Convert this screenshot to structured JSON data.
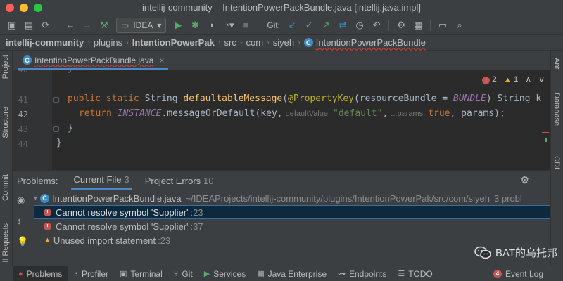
{
  "window": {
    "title": "intellij-community – IntentionPowerPackBundle.java [intellij.java.impl]"
  },
  "toolbar": {
    "run_config": "IDEA",
    "git_label": "Git:"
  },
  "breadcrumb": [
    {
      "label": "intellij-community",
      "bold": true
    },
    {
      "label": "plugins",
      "bold": false
    },
    {
      "label": "IntentionPowerPak",
      "bold": true
    },
    {
      "label": "src",
      "bold": false
    },
    {
      "label": "com",
      "bold": false
    },
    {
      "label": "siyeh",
      "bold": false
    },
    {
      "label": "IntentionPowerPackBundle",
      "bold": false,
      "class_icon": true
    }
  ],
  "left_stripe": {
    "project": "Project",
    "structure": "Structure",
    "commit": "Commit",
    "requests": "II Requests"
  },
  "right_stripe": {
    "ant": "Ant",
    "database": "Database",
    "cdi": "CDI"
  },
  "editor_tab": {
    "label": "IntentionPowerPackBundle.java",
    "icon": "C"
  },
  "inspections": {
    "errors": "2",
    "warnings": "1"
  },
  "editor": {
    "lines": [
      {
        "num": "40",
        "code": "}"
      },
      {
        "num": "41",
        "kw1": "public static ",
        "type": "String ",
        "fn": "defaultableMessage",
        "p1": "(",
        "ann": "@PropertyKey",
        "p2": "(resourceBundle = ",
        "const": "BUNDLE",
        "p3": ") String k"
      },
      {
        "num": "42",
        "kw": "return ",
        "const": "INSTANCE",
        "m": ".messageOrDefault(key,",
        "hint1": "defaultValue:",
        "str": "\"default\"",
        "comma": ",",
        "hint2": "...params:",
        "kw2": "true",
        "rest": ", params);"
      },
      {
        "num": "43",
        "code": "}"
      },
      {
        "num": "44",
        "code": "}"
      }
    ]
  },
  "problems": {
    "title": "Problems:",
    "tabs": [
      {
        "label": "Current File",
        "count": "3",
        "active": true
      },
      {
        "label": "Project Errors",
        "count": "10",
        "active": false
      }
    ],
    "file": {
      "name": "IntentionPowerPackBundle.java",
      "path": "~/IDEAProjects/intellij-community/plugins/IntentionPowerPak/src/com/siyeh",
      "count": "3 probl"
    },
    "items": [
      {
        "severity": "error",
        "message": "Cannot resolve symbol 'Supplier'",
        "loc": ":23",
        "selected": true
      },
      {
        "severity": "error",
        "message": "Cannot resolve symbol 'Supplier'",
        "loc": ":37",
        "selected": false
      },
      {
        "severity": "warning",
        "message": "Unused import statement",
        "loc": ":23",
        "selected": false
      }
    ]
  },
  "bottombar": [
    {
      "label": "Problems",
      "icon": "problems-icon",
      "active": true
    },
    {
      "label": "Profiler",
      "icon": "profiler-icon"
    },
    {
      "label": "Terminal",
      "icon": "terminal-icon"
    },
    {
      "label": "Git",
      "icon": "git-icon"
    },
    {
      "label": "Services",
      "icon": "services-icon"
    },
    {
      "label": "Java Enterprise",
      "icon": "java-enterprise-icon"
    },
    {
      "label": "Endpoints",
      "icon": "endpoints-icon"
    },
    {
      "label": "TODO",
      "icon": "todo-icon"
    },
    {
      "label": "Event Log",
      "icon": "event-log-icon",
      "badge": "4"
    }
  ],
  "watermark": {
    "text": "BAT的乌托邦"
  },
  "colors": {
    "accent": "#4a88c7",
    "error": "#c75450",
    "warning": "#e6b422",
    "run": "#59a869"
  }
}
